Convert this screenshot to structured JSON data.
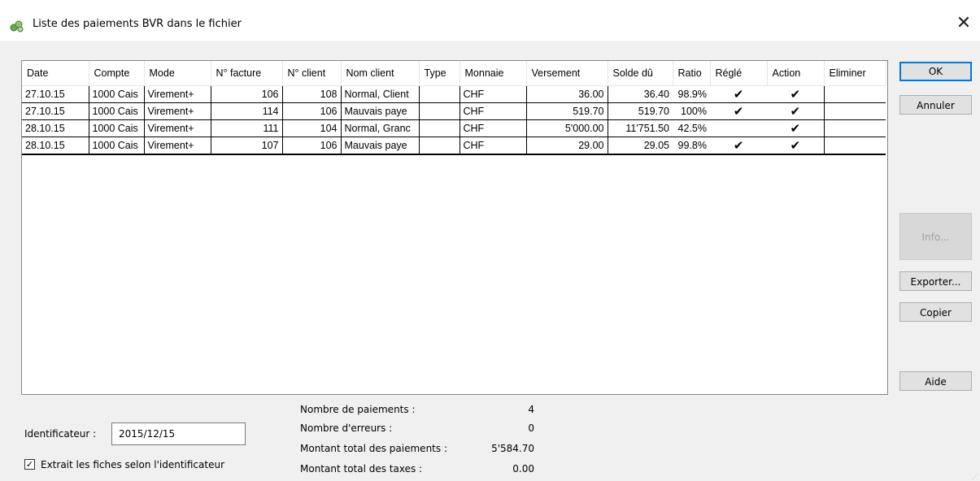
{
  "window": {
    "title": "Liste des paiements BVR dans le fichier",
    "close_glyph": "✕"
  },
  "table": {
    "columns": [
      "Date",
      "Compte",
      "Mode",
      "N° facture",
      "N° client",
      "Nom client",
      "Type",
      "Monnaie",
      "Versement",
      "Solde dû",
      "Ratio",
      "Réglé",
      "Action",
      "Eliminer"
    ],
    "rows": [
      {
        "date": "27.10.15",
        "compte": "1000 Cais",
        "mode": "Virement+",
        "facture": "106",
        "client": "108",
        "nom": "Normal, Client",
        "type": "",
        "monnaie": "CHF",
        "versement": "36.00",
        "solde": "36.40",
        "ratio": "98.9%",
        "regle": "✔",
        "action": "✔",
        "eliminer": ""
      },
      {
        "date": "27.10.15",
        "compte": "1000 Cais",
        "mode": "Virement+",
        "facture": "114",
        "client": "106",
        "nom": "Mauvais paye",
        "type": "",
        "monnaie": "CHF",
        "versement": "519.70",
        "solde": "519.70",
        "ratio": "100%",
        "regle": "✔",
        "action": "✔",
        "eliminer": ""
      },
      {
        "date": "28.10.15",
        "compte": "1000 Cais",
        "mode": "Virement+",
        "facture": "111",
        "client": "104",
        "nom": "Normal, Granc",
        "type": "",
        "monnaie": "CHF",
        "versement": "5'000.00",
        "solde": "11'751.50",
        "ratio": "42.5%",
        "regle": "",
        "action": "✔",
        "eliminer": ""
      },
      {
        "date": "28.10.15",
        "compte": "1000 Cais",
        "mode": "Virement+",
        "facture": "107",
        "client": "106",
        "nom": "Mauvais paye",
        "type": "",
        "monnaie": "CHF",
        "versement": "29.00",
        "solde": "29.05",
        "ratio": "99.8%",
        "regle": "✔",
        "action": "✔",
        "eliminer": ""
      }
    ]
  },
  "buttons": {
    "ok": "OK",
    "cancel": "Annuler",
    "info": "Info...",
    "export": "Exporter...",
    "copy": "Copier",
    "help": "Aide"
  },
  "identifier": {
    "label": "Identificateur :",
    "value": "2015/12/15",
    "checkbox_label": "Extrait les fiches selon l'identificateur",
    "checked": true
  },
  "summary": {
    "payments_count_label": "Nombre de paiements :",
    "payments_count": "4",
    "errors_label": "Nombre d'erreurs :",
    "errors": "0",
    "total_label": "Montant total des paiements :",
    "total": "5'584.70",
    "taxes_label": "Montant total des taxes :",
    "taxes": "0.00"
  }
}
